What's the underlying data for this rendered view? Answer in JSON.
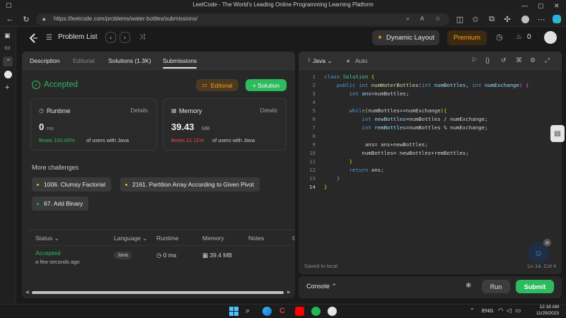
{
  "browser": {
    "window_title": "LeetCode - The World's Leading Online Programming Learning Platform",
    "url": "https://leetcode.com/problems/water-bottles/submissions/"
  },
  "navbar": {
    "problem_list_label": "Problem List",
    "dynamic_layout_label": "Dynamic Layout",
    "premium_label": "Premium",
    "streak_count": "0"
  },
  "left_tabs": [
    {
      "label": "Description"
    },
    {
      "label": "Editorial"
    },
    {
      "label": "Solutions (1.3K)"
    },
    {
      "label": "Submissions"
    }
  ],
  "result": {
    "status": "Accepted",
    "editorial_button": "Editorial",
    "solution_button": "+ Solution",
    "runtime": {
      "title": "Runtime",
      "details": "Details",
      "value": "0",
      "unit": "ms",
      "beats": "Beats 100.00%",
      "beats_suffix": "of users with Java"
    },
    "memory": {
      "title": "Memory",
      "details": "Details",
      "value": "39.43",
      "unit": "MB",
      "beats": "Beats 21.11%",
      "beats_suffix": "of users with Java"
    }
  },
  "challenges": {
    "title": "More challenges",
    "items": [
      {
        "label": "1006. Clumsy Factorial",
        "color": "#ffb800"
      },
      {
        "label": "2161. Partition Array According to Given Pivot",
        "color": "#ffb800"
      },
      {
        "label": "67. Add Binary",
        "color": "#00b8a3"
      }
    ]
  },
  "submissions_table": {
    "headers": [
      "Status",
      "Language",
      "Runtime",
      "Memory",
      "Notes"
    ],
    "rows": [
      {
        "status": "Accepted",
        "time": "a few seconds ago",
        "language": "Java",
        "runtime": "0 ms",
        "memory": "39.4 MB",
        "notes": ""
      }
    ]
  },
  "editor": {
    "language": "Java",
    "mode": "Auto",
    "saved_status": "Saved to local",
    "cursor_position": "Ln 14, Col 4",
    "line_numbers": [
      "1",
      "2",
      "3",
      "4",
      "5",
      "6",
      "7",
      "8",
      "9",
      "10",
      "11",
      "12",
      "13",
      "14"
    ]
  },
  "console": {
    "label": "Console",
    "run_label": "Run",
    "submit_label": "Submit"
  },
  "taskbar": {
    "language": "ENG",
    "time": "12:18 AM",
    "date": "11/29/2023"
  },
  "colors": {
    "accepted_green": "#2cbb5d",
    "beats_red": "#ef4743",
    "premium_orange": "#ffa116",
    "submit_green": "#2cbb5d"
  }
}
